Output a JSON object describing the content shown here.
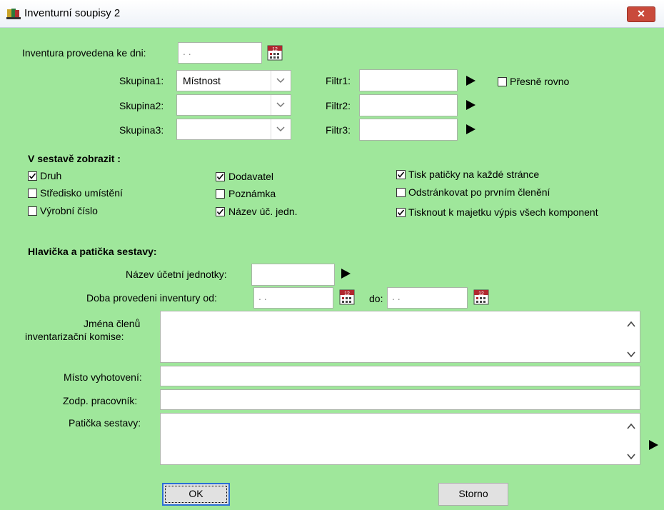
{
  "window": {
    "title": "Inventurní soupisy 2",
    "close_label": "✕"
  },
  "inventory": {
    "label": "Inventura provedena ke dni:",
    "date_value": " . ."
  },
  "groups": [
    {
      "label": "Skupina1:",
      "value": "Místnost"
    },
    {
      "label": "Skupina2:",
      "value": ""
    },
    {
      "label": "Skupina3:",
      "value": ""
    }
  ],
  "filters": [
    {
      "label": "Filtr1:",
      "value": ""
    },
    {
      "label": "Filtr2:",
      "value": ""
    },
    {
      "label": "Filtr3:",
      "value": ""
    }
  ],
  "exact_match": {
    "label": "Přesně rovno",
    "checked": false
  },
  "display_section": {
    "heading": "V sestavě zobrazit :",
    "checks": [
      {
        "label": "Druh",
        "checked": true
      },
      {
        "label": "Středisko umístění",
        "checked": false
      },
      {
        "label": "Výrobní číslo",
        "checked": false
      },
      {
        "label": "Dodavatel",
        "checked": true
      },
      {
        "label": "Poznámka",
        "checked": false
      },
      {
        "label": "Název úč. jedn.",
        "checked": true
      },
      {
        "label": "Tisk patičky na každé stránce",
        "checked": true
      },
      {
        "label": "Odstránkovat po prvním členění",
        "checked": false
      },
      {
        "label": "Tisknout k majetku výpis všech komponent",
        "checked": true
      }
    ]
  },
  "header_section": {
    "heading": "Hlavička a patička sestavy:",
    "unit_label": "Název účetní jednotky:",
    "unit_value": "",
    "period_label": "Doba provedeni inventury od:",
    "period_from": " . .",
    "period_to_label": "do:",
    "period_to": " . .",
    "members_label_1": "Jména členů",
    "members_label_2": "inventarizační komise:",
    "place_label": "Místo vyhotovení:",
    "place_value": "",
    "responsible_label": "Zodp. pracovník:",
    "responsible_value": "",
    "footer_label": "Patička sestavy:",
    "footer_value": ""
  },
  "buttons": {
    "ok": "OK",
    "cancel": "Storno"
  },
  "colors": {
    "background": "#9fe79b",
    "close": "#c94a3b",
    "focus": "#2b6fd6"
  }
}
